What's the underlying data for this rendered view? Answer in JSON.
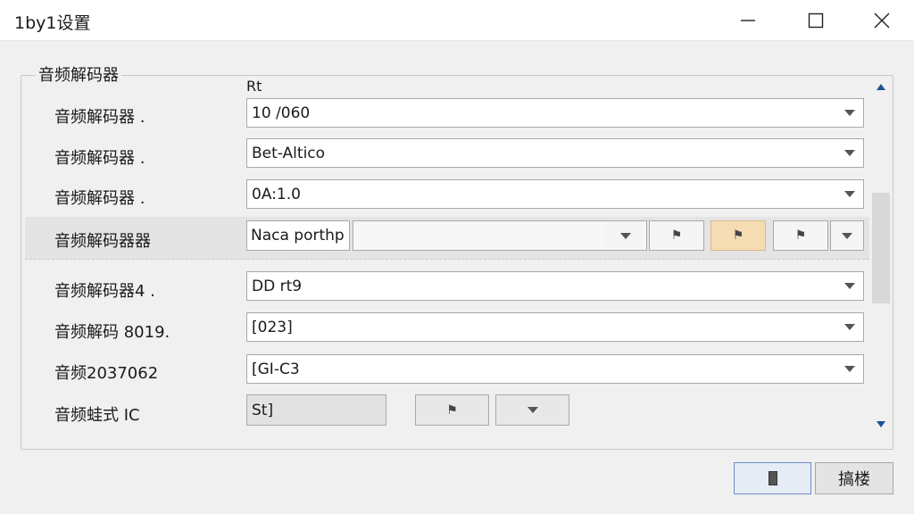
{
  "window": {
    "title": "1by1设置"
  },
  "group": {
    "title": "音频解码器",
    "column_header": "Rt"
  },
  "rows": [
    {
      "label": "音频解码器 .",
      "value": "10 /060"
    },
    {
      "label": "音频解码器 .",
      "value": "Bet-Altico"
    },
    {
      "label": "音频解码器 .",
      "value": "0A:1.0"
    },
    {
      "label": "音频解码器器",
      "value": "Naca porthp"
    },
    {
      "label": "音频解码器4 .",
      "value": "DD rt9"
    },
    {
      "label": "音频解码 8019.",
      "value": "[023]"
    },
    {
      "label": "音频2037062",
      "value": "[GI-C3"
    },
    {
      "label": "音频蛙式 IC",
      "value": "St]"
    }
  ],
  "footer": {
    "cancel_label": "搞楼"
  },
  "colors": {
    "accent_segment": "#f5dcb3",
    "scroll_arrow": "#1f4f99",
    "highlight_row": "#e4e4e4"
  }
}
